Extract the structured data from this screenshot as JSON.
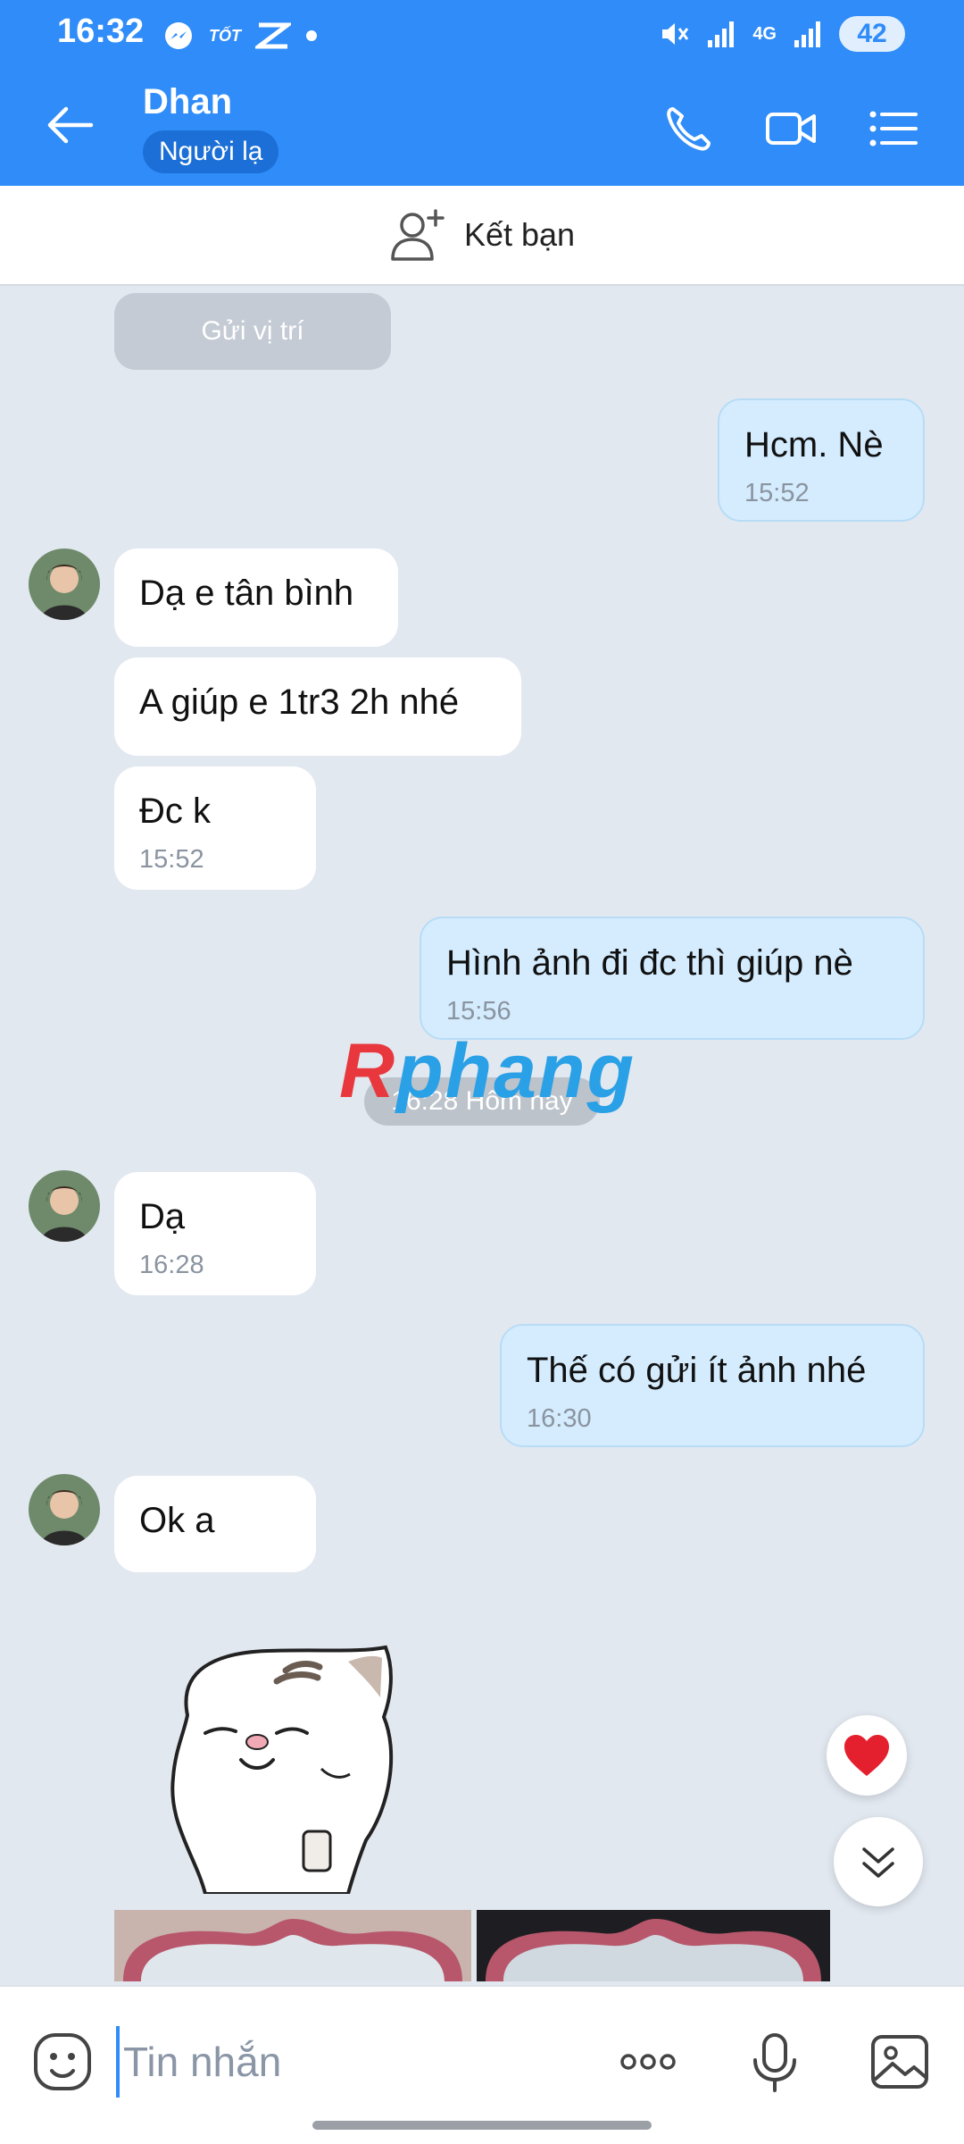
{
  "status_bar": {
    "time": "16:32",
    "carrier_badge": "TỐT",
    "battery": "42",
    "network": "4G"
  },
  "header": {
    "contact_name": "Dhan",
    "contact_status": "Người lạ"
  },
  "friend_bar": {
    "label": "Kết bạn"
  },
  "chat": {
    "location_label": "Gửi vị trí",
    "messages": [
      {
        "side": "out",
        "text": "Hcm. Nè",
        "time": "15:52"
      },
      {
        "side": "in",
        "text": "Dạ e tân bình",
        "time": ""
      },
      {
        "side": "in",
        "text": "A giúp e 1tr3 2h nhé",
        "time": ""
      },
      {
        "side": "in",
        "text": "Đc k",
        "time": "15:52"
      },
      {
        "side": "out",
        "text": "Hình ảnh đi đc thì giúp nè",
        "time": "15:56"
      },
      {
        "side": "in",
        "text": "Dạ",
        "time": "16:28"
      },
      {
        "side": "out",
        "text": "Thế có gửi ít ảnh nhé",
        "time": "16:30"
      },
      {
        "side": "in",
        "text": "Ok a",
        "time": ""
      }
    ],
    "date_separator": "16:28 Hôm nay",
    "watermark": {
      "part1": "R",
      "part2": "phang"
    }
  },
  "input_bar": {
    "placeholder": "Tin nhắn"
  },
  "colors": {
    "brand": "#2f8cf8",
    "incoming_bubble": "#ffffff",
    "outgoing_bubble": "#d4ecfe",
    "chat_background": "#e2e8f0"
  },
  "icons": [
    "back-arrow-icon",
    "phone-icon",
    "video-call-icon",
    "menu-list-icon",
    "add-friend-icon",
    "heart-icon",
    "scroll-down-icon",
    "emoji-icon",
    "more-icon",
    "mic-icon",
    "gallery-icon"
  ]
}
